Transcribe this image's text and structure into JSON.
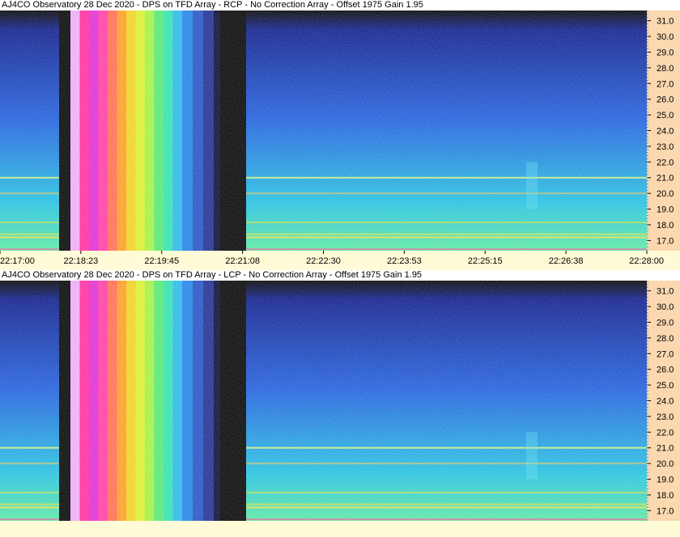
{
  "chart_data": [
    {
      "type": "heatmap",
      "title": "AJ4CO Observatory 28 Dec 2020 - DPS on TFD Array  - RCP  -  No Correction Array  -  Offset 1975  Gain 1.95",
      "xlabel": "",
      "ylabel": "",
      "x_ticks": [
        "22:17:00",
        "22:18:23",
        "22:19:45",
        "22:21:08",
        "22:22:30",
        "22:23:53",
        "22:25:15",
        "22:26:38",
        "22:28:00"
      ],
      "y_ticks": [
        "31.0",
        "30.0",
        "29.0",
        "28.0",
        "27.0",
        "26.0",
        "25.0",
        "24.0",
        "23.0",
        "22.0",
        "21.0",
        "20.0",
        "19.0",
        "18.0",
        "17.0"
      ],
      "ylim": [
        16.35,
        31.65
      ],
      "grid": false,
      "colormap": [
        "#000000",
        "#0a1a8a",
        "#1c5cdc",
        "#21c0e0",
        "#58e8a0",
        "#e0f040",
        "#ff8a20",
        "#ff2a9c",
        "#f0a8f8"
      ]
    },
    {
      "type": "heatmap",
      "title": "AJ4CO Observatory 28 Dec 2020 - DPS on TFD Array  - LCP  -  No Correction Array  -  Offset 1975  Gain 1.95",
      "xlabel": "",
      "ylabel": "",
      "x_ticks": [],
      "y_ticks": [
        "31.0",
        "30.0",
        "29.0",
        "28.0",
        "27.0",
        "26.0",
        "25.0",
        "24.0",
        "23.0",
        "22.0",
        "21.0",
        "20.0",
        "19.0",
        "18.0",
        "17.0"
      ],
      "ylim": [
        16.35,
        31.65
      ],
      "grid": false,
      "colormap": [
        "#000000",
        "#0a1a8a",
        "#1c5cdc",
        "#21c0e0",
        "#58e8a0",
        "#e0f040",
        "#ff8a20",
        "#ff2a9c",
        "#f0a8f8"
      ]
    }
  ]
}
